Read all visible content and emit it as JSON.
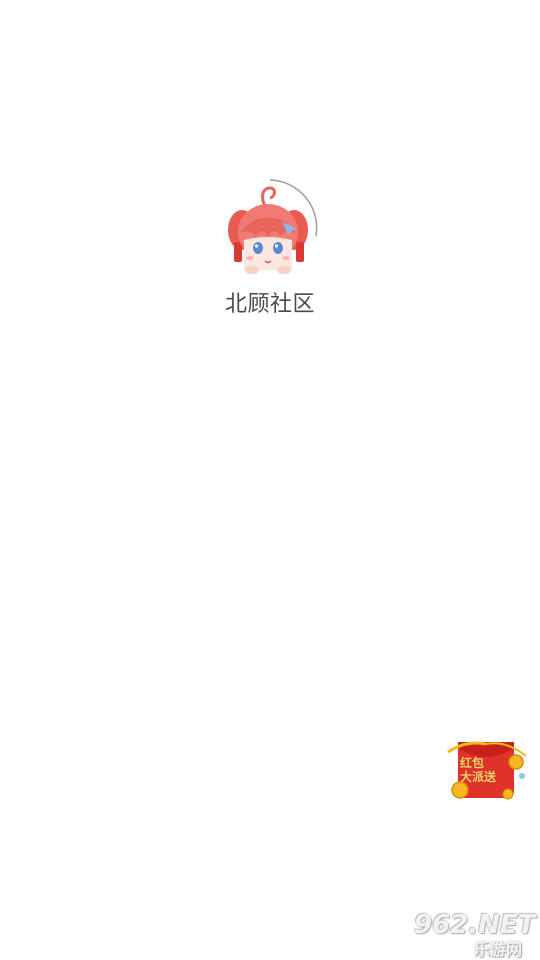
{
  "splash": {
    "app_name": "北顾社区"
  },
  "promo": {
    "red_packet_line1": "红包",
    "red_packet_line2": "大派送",
    "icon": "red-envelope-icon"
  },
  "watermark": {
    "brand": "962.NET",
    "sub": "乐游网"
  },
  "colors": {
    "background": "#ffffff",
    "text": "#4a4a4a",
    "accent_red": "#e0312a",
    "coin_gold": "#f5b81e",
    "mascot_hair": "#ef7b74"
  }
}
